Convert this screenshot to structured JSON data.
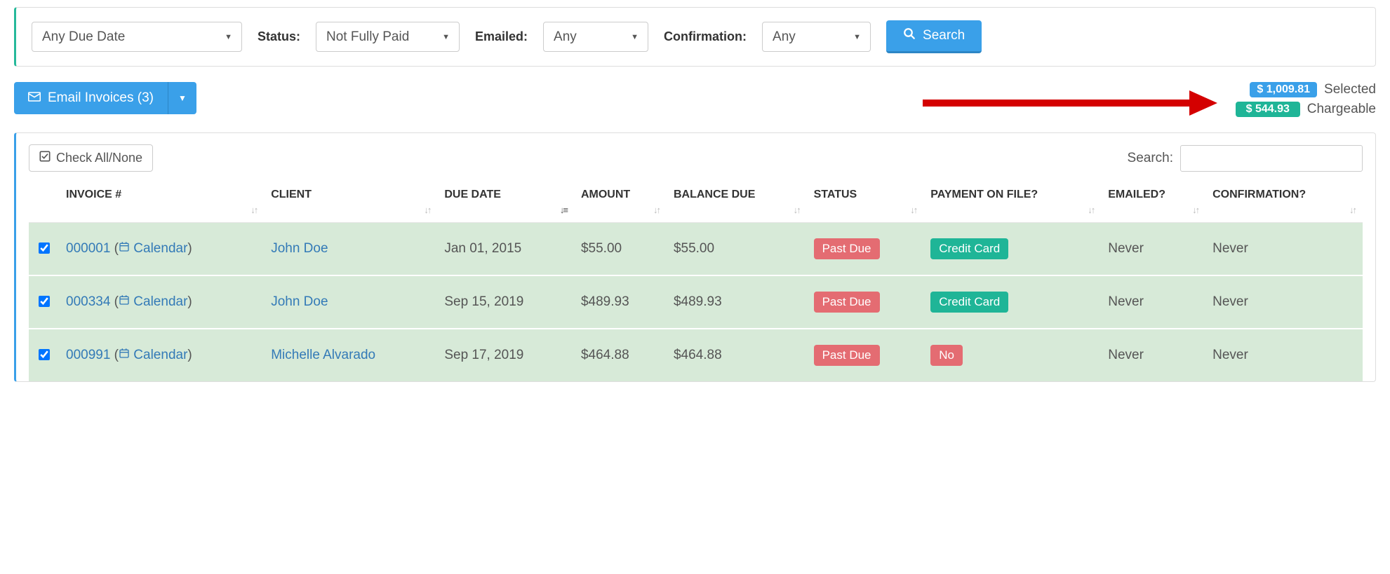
{
  "filters": {
    "due_date": "Any Due Date",
    "status_label": "Status:",
    "status": "Not Fully Paid",
    "emailed_label": "Emailed:",
    "emailed": "Any",
    "confirm_label": "Confirmation:",
    "confirm": "Any",
    "search_btn": "Search"
  },
  "actions": {
    "email_invoices": "Email Invoices (3)",
    "check_all": "Check All/None",
    "search_label": "Search:"
  },
  "totals": {
    "selected_amount": "$ 1,009.81",
    "selected_label": "Selected",
    "chargeable_amount": "$ 544.93",
    "chargeable_label": "Chargeable"
  },
  "columns": {
    "invoice": "INVOICE #",
    "client": "CLIENT",
    "due": "DUE DATE",
    "amount": "AMOUNT",
    "balance": "BALANCE DUE",
    "status": "STATUS",
    "payment": "PAYMENT ON FILE?",
    "emailed": "EMAILED?",
    "confirm": "CONFIRMATION?"
  },
  "rows": [
    {
      "checked": true,
      "invoice_no": "000001",
      "calendar_link": "Calendar",
      "client": "John Doe",
      "due": "Jan 01, 2015",
      "amount": "$55.00",
      "balance": "$55.00",
      "status": "Past Due",
      "payment": "Credit Card",
      "payment_class": "green",
      "emailed": "Never",
      "confirm": "Never"
    },
    {
      "checked": true,
      "invoice_no": "000334",
      "calendar_link": "Calendar",
      "client": "John Doe",
      "due": "Sep 15, 2019",
      "amount": "$489.93",
      "balance": "$489.93",
      "status": "Past Due",
      "payment": "Credit Card",
      "payment_class": "green",
      "emailed": "Never",
      "confirm": "Never"
    },
    {
      "checked": true,
      "invoice_no": "000991",
      "calendar_link": "Calendar",
      "client": "Michelle Alvarado",
      "due": "Sep 17, 2019",
      "amount": "$464.88",
      "balance": "$464.88",
      "status": "Past Due",
      "payment": "No",
      "payment_class": "red",
      "emailed": "Never",
      "confirm": "Never"
    }
  ]
}
